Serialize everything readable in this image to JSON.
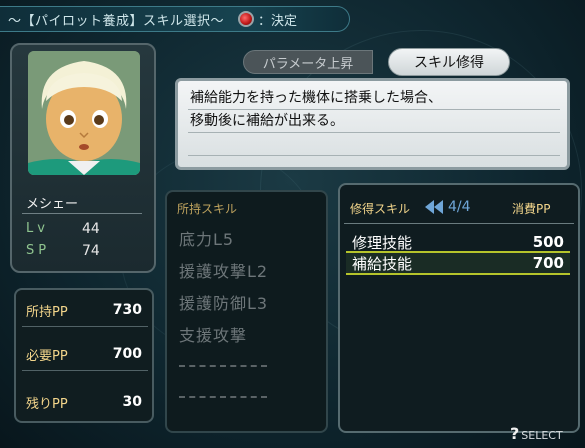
{
  "header": {
    "title": "～【パイロット養成】スキル選択～",
    "confirm_label": "：決定"
  },
  "pilot": {
    "name": "メシェー",
    "lv_label": "Lv",
    "lv_value": "44",
    "sp_label": "SP",
    "sp_value": "74"
  },
  "pp": {
    "owned_label": "所持PP",
    "owned_value": "730",
    "required_label": "必要PP",
    "required_value": "700",
    "remaining_label": "残りPP",
    "remaining_value": "30"
  },
  "tabs": {
    "param_label": "パラメータ上昇",
    "skill_label": "スキル修得"
  },
  "description": {
    "line1": "補給能力を持った機体に搭乗した場合、",
    "line2": "移動後に補給が出来る。"
  },
  "owned_skills": {
    "header": "所持スキル",
    "items": [
      "底力L5",
      "援護攻撃L2",
      "援護防御L3",
      "支援攻撃"
    ]
  },
  "acquire": {
    "header": "修得スキル",
    "page": "4/4",
    "cost_header": "消費PP",
    "items": [
      {
        "name": "修理技能",
        "cost": "500"
      },
      {
        "name": "補給技能",
        "cost": "700"
      }
    ]
  },
  "footer": {
    "select_icon": "?",
    "select_label": "SELECT"
  },
  "colors": {
    "accent_yellow": "#f2d58b",
    "selection_bar": "#b5c42b",
    "page_blue": "#6fa6d8"
  }
}
